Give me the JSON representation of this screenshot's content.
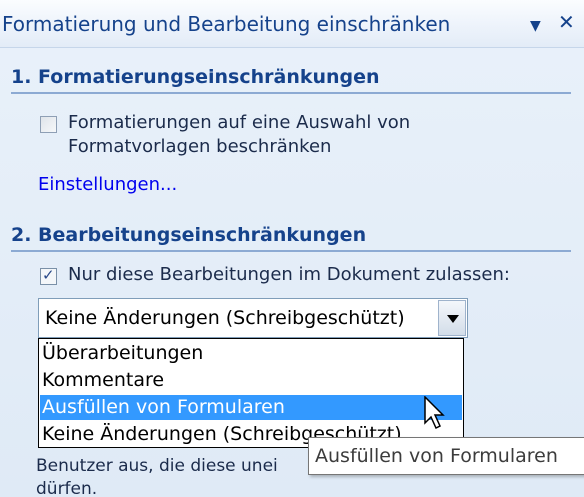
{
  "pane": {
    "title": "Formatierung und Bearbeitung einschränken",
    "menu_icon": "dropdown-arrow-icon",
    "close_icon": "close-icon"
  },
  "section1": {
    "heading": "1. Formatierungseinschränkungen",
    "checkbox_checked": false,
    "checkbox_label_line1": "Formatierungen auf eine Auswahl von",
    "checkbox_label_line2": "Formatvorlagen beschränken",
    "settings_link": "Einstellungen..."
  },
  "section2": {
    "heading": "2. Bearbeitungseinschränkungen",
    "checkbox_checked": true,
    "checkbox_label": "Nur diese Bearbeitungen im Dokument zulassen:",
    "select": {
      "value": "Keine Änderungen (Schreibgeschützt)",
      "options": [
        "Überarbeitungen",
        "Kommentare",
        "Ausfüllen von Formularen",
        "Keine Änderungen (Schreibgeschützt)"
      ],
      "highlighted_index": 2
    },
    "partial_text_line1": "Benutzer aus, die diese unei",
    "partial_text_line2": "dürfen."
  },
  "tooltip": {
    "text": "Ausfüllen von Formularen"
  },
  "colors": {
    "heading": "#15428b",
    "link": "#0000ee",
    "highlight": "#3399ff",
    "pane_background": "#e4edf8"
  }
}
